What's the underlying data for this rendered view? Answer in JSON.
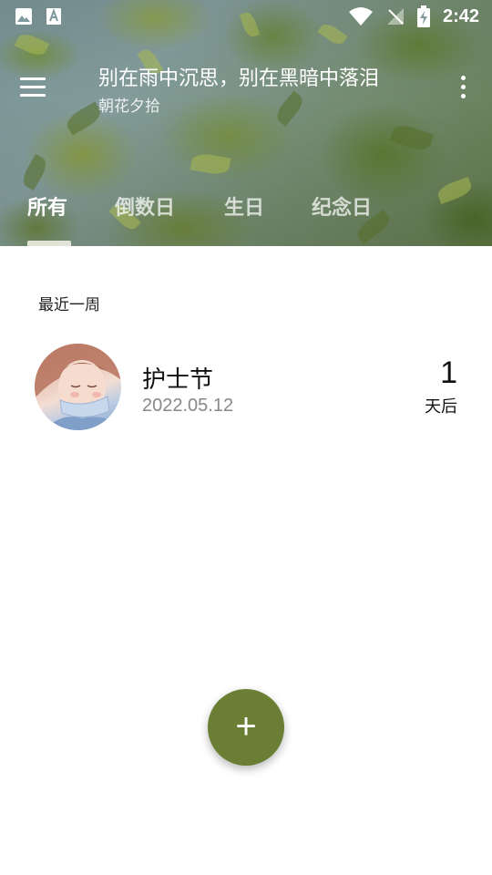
{
  "status_bar": {
    "time": "2:42",
    "left_icons": [
      "image-icon",
      "text-a-icon"
    ],
    "right_icons": [
      "wifi-icon",
      "no-signal-icon",
      "battery-charging-icon"
    ]
  },
  "toolbar": {
    "title": "别在雨中沉思，别在黑暗中落泪",
    "subtitle": "朝花夕拾",
    "menu_icon": "hamburger-menu-icon",
    "more_icon": "more-vertical-icon"
  },
  "tabs": {
    "items": [
      {
        "label": "所有",
        "active": true
      },
      {
        "label": "倒数日",
        "active": false
      },
      {
        "label": "生日",
        "active": false
      },
      {
        "label": "纪念日",
        "active": false
      }
    ]
  },
  "content": {
    "section_title": "最近一周",
    "events": [
      {
        "name": "护士节",
        "date": "2022.05.12",
        "count": "1",
        "unit": "天后",
        "avatar_icon": "nurse-avatar"
      }
    ]
  },
  "fab": {
    "label": "+",
    "icon": "plus-icon"
  },
  "colors": {
    "accent": "#6a7f34",
    "text_primary": "#111111",
    "text_secondary": "#888888"
  }
}
